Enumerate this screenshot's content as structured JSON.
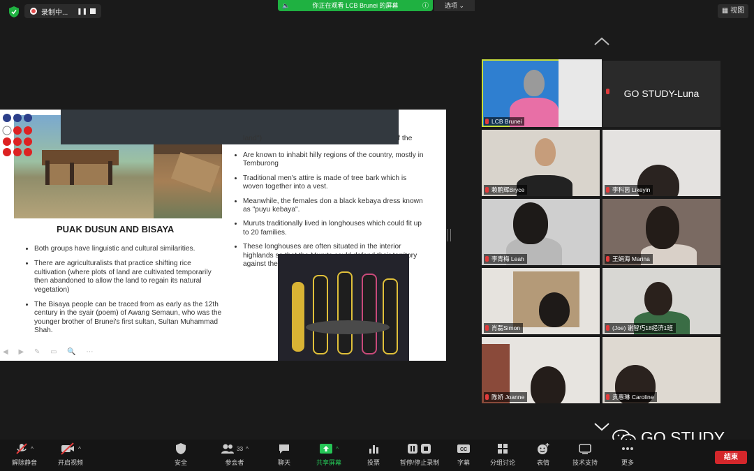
{
  "top_bar": {
    "recording_label": "录制中...",
    "sharing_banner": "你正在观看 LCB Brunei 的屏幕",
    "options_label": "选项",
    "view_label": "视图"
  },
  "slide": {
    "heading": "PUAK DUSUN AND BISAYA",
    "left_bullets": [
      "Both groups have linguistic and cultural similarities.",
      "There are agriculturalists that practice shifting rice cultivation (where plots of land are cultivated temporarily then abandoned to allow the land to regain its natural vegetation)",
      "The Bisaya people can be traced from as early as the 12th century in the syair (poem) of Awang Semaun, who was the younger brother of Brunei's first sultan, Sultan Muhammad Shah."
    ],
    "right_fragment_1": "land\")",
    "right_fragment_2": "f the",
    "right_bullets": [
      "Are known to inhabit hilly regions of the country, mostly in Temburong",
      "Traditional men's attire is made of tree bark which is woven together into a vest.",
      "Meanwhile, the females don a black kebaya dress known as \"puyu kebaya\".",
      "Muruts traditionally lived in longhouses which could fit up to 20 families.",
      "These longhouses are often situated in the interior highlands so that the Muruts could defend their territory against their enemies."
    ]
  },
  "participants": [
    {
      "name": "LCB Brunei"
    },
    {
      "name": "GO STUDY-Luna"
    },
    {
      "name": "赖鹏辉Bryce"
    },
    {
      "name": "李科茵 Likeyin"
    },
    {
      "name": "李青梅 Leah"
    },
    {
      "name": "王娟海 Marina"
    },
    {
      "name": "肖磊Simon"
    },
    {
      "name": "(Joe) 谢智巧18经济1班"
    },
    {
      "name": "陈娇 Joanne"
    },
    {
      "name": "贲惠琳 Caroline"
    }
  ],
  "toolbar": {
    "unmute": "解除静音",
    "start_video": "开启视频",
    "security": "安全",
    "participants": "参会者",
    "participant_count": "33",
    "chat": "聊天",
    "share_screen": "共享屏幕",
    "polls": "投票",
    "pause_stop_recording": "暂停/停止录制",
    "captions": "字幕",
    "breakout_rooms": "分组讨论",
    "reactions": "表情",
    "tech_support": "技术支持",
    "more": "更多",
    "end": "结束"
  },
  "watermark": "GO STUDY",
  "colors": {
    "share_green": "#1fb141",
    "active_speaker": "#c7dd3b",
    "end_red": "#d4272b"
  }
}
